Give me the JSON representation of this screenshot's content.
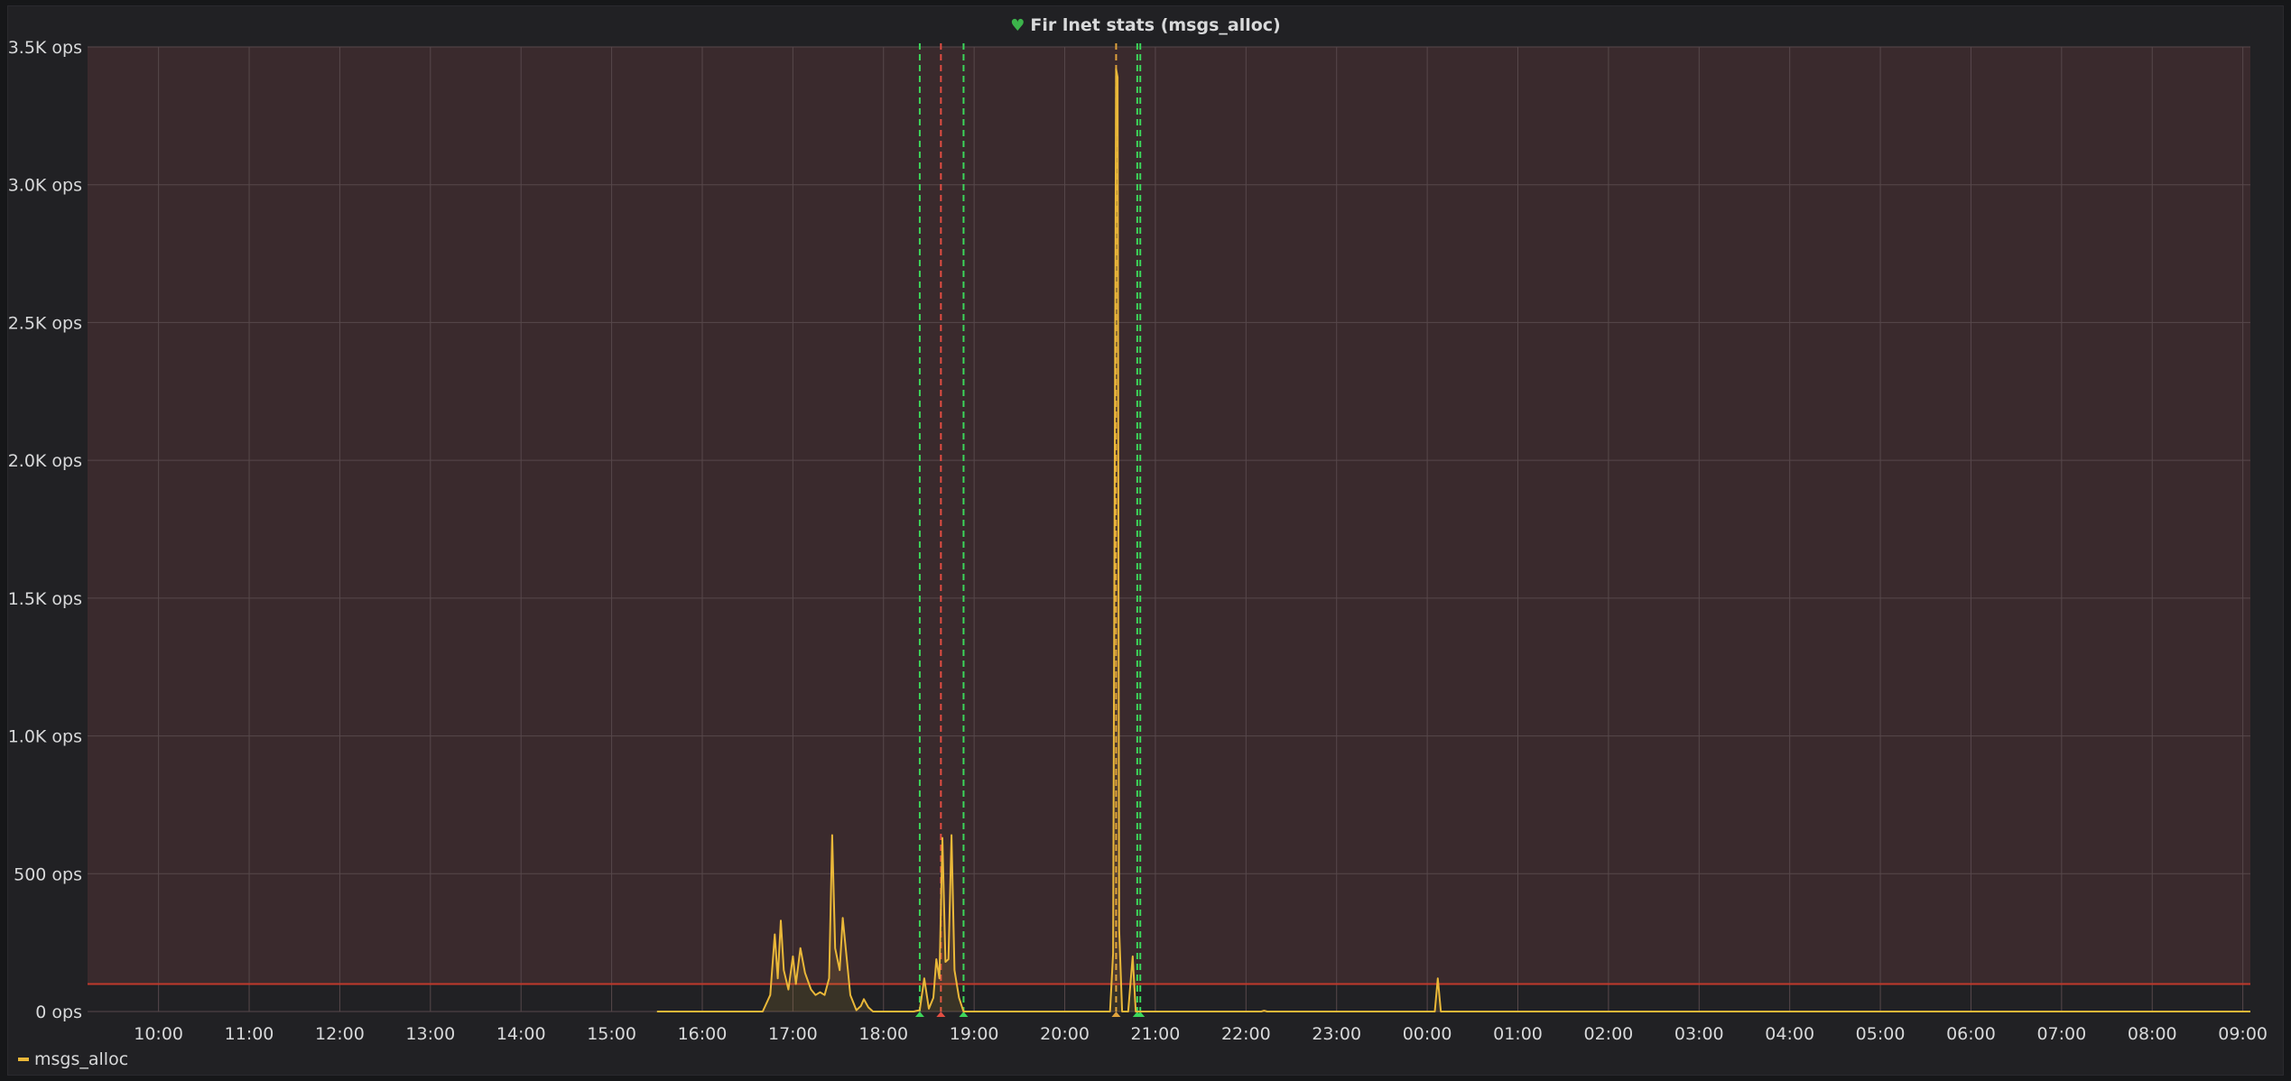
{
  "panel": {
    "title": "Fir lnet stats (msgs_alloc)",
    "title_icon": "heart-icon"
  },
  "legend": {
    "items": [
      {
        "label": "msgs_alloc",
        "color": "#eab839"
      }
    ]
  },
  "colors": {
    "series": "#eab839",
    "threshold_line": "#c0392b",
    "threshold_fill": "#3a2a2d",
    "annotation_green": "#3cd65a",
    "annotation_red": "#e24d42",
    "annotation_yellow": "#e0a23c"
  },
  "chart_data": {
    "type": "line",
    "title": "Fir lnet stats (msgs_alloc)",
    "xlabel": "",
    "ylabel": "",
    "xlim": [
      "09:13",
      "09:05"
    ],
    "ylim": [
      0,
      3500
    ],
    "y_ticks": [
      {
        "value": 0,
        "label": "0 ops"
      },
      {
        "value": 500,
        "label": "500 ops"
      },
      {
        "value": 1000,
        "label": "1.0K ops"
      },
      {
        "value": 1500,
        "label": "1.5K ops"
      },
      {
        "value": 2000,
        "label": "2.0K ops"
      },
      {
        "value": 2500,
        "label": "2.5K ops"
      },
      {
        "value": 3000,
        "label": "3.0K ops"
      },
      {
        "value": 3500,
        "label": "3.5K ops"
      }
    ],
    "x_ticks": [
      "10:00",
      "11:00",
      "12:00",
      "13:00",
      "14:00",
      "15:00",
      "16:00",
      "17:00",
      "18:00",
      "19:00",
      "20:00",
      "21:00",
      "22:00",
      "23:00",
      "00:00",
      "01:00",
      "02:00",
      "03:00",
      "04:00",
      "05:00",
      "06:00",
      "07:00",
      "08:00",
      "09:00"
    ],
    "grid": true,
    "legend_position": "bottom-left",
    "threshold": {
      "value": 100,
      "fill": "above"
    },
    "annotations": [
      {
        "x": "18:24",
        "color": "green"
      },
      {
        "x": "18:38",
        "color": "red"
      },
      {
        "x": "18:53",
        "color": "green"
      },
      {
        "x": "20:34",
        "color": "yellow"
      },
      {
        "x": "20:48",
        "color": "green"
      },
      {
        "x": "20:50",
        "color": "green"
      }
    ],
    "series": [
      {
        "name": "msgs_alloc",
        "points": [
          [
            "15:30",
            0
          ],
          [
            "16:40",
            0
          ],
          [
            "16:45",
            60
          ],
          [
            "16:48",
            280
          ],
          [
            "16:50",
            120
          ],
          [
            "16:52",
            330
          ],
          [
            "16:54",
            150
          ],
          [
            "16:57",
            80
          ],
          [
            "17:00",
            200
          ],
          [
            "17:02",
            100
          ],
          [
            "17:05",
            230
          ],
          [
            "17:08",
            140
          ],
          [
            "17:12",
            80
          ],
          [
            "17:15",
            60
          ],
          [
            "17:18",
            70
          ],
          [
            "17:21",
            60
          ],
          [
            "17:24",
            120
          ],
          [
            "17:26",
            640
          ],
          [
            "17:28",
            230
          ],
          [
            "17:31",
            150
          ],
          [
            "17:33",
            340
          ],
          [
            "17:35",
            230
          ],
          [
            "17:38",
            60
          ],
          [
            "17:42",
            5
          ],
          [
            "17:45",
            20
          ],
          [
            "17:47",
            45
          ],
          [
            "17:50",
            15
          ],
          [
            "17:53",
            0
          ],
          [
            "18:20",
            0
          ],
          [
            "18:24",
            5
          ],
          [
            "18:27",
            120
          ],
          [
            "18:30",
            10
          ],
          [
            "18:33",
            50
          ],
          [
            "18:35",
            190
          ],
          [
            "18:37",
            120
          ],
          [
            "18:39",
            630
          ],
          [
            "18:41",
            180
          ],
          [
            "18:43",
            190
          ],
          [
            "18:45",
            640
          ],
          [
            "18:47",
            150
          ],
          [
            "18:50",
            50
          ],
          [
            "18:53",
            0
          ],
          [
            "20:30",
            0
          ],
          [
            "20:32",
            210
          ],
          [
            "20:34",
            3420
          ],
          [
            "20:35",
            3390
          ],
          [
            "20:36",
            300
          ],
          [
            "20:38",
            0
          ],
          [
            "20:42",
            0
          ],
          [
            "20:45",
            200
          ],
          [
            "20:47",
            0
          ],
          [
            "22:10",
            0
          ],
          [
            "22:12",
            3
          ],
          [
            "22:14",
            0
          ],
          [
            "00:05",
            0
          ],
          [
            "00:07",
            120
          ],
          [
            "00:09",
            0
          ],
          [
            "09:05",
            0
          ]
        ]
      }
    ]
  }
}
